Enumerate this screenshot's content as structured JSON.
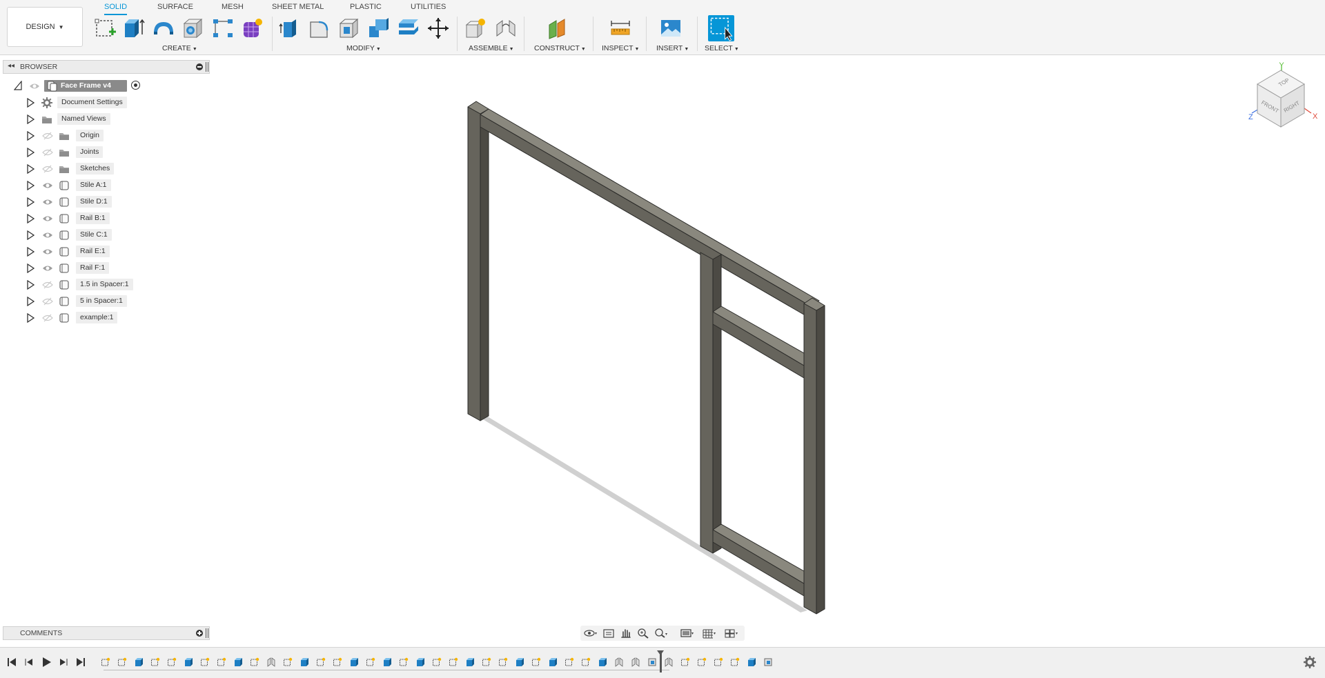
{
  "toolbar": {
    "design_label": "DESIGN",
    "tabs": [
      "SOLID",
      "SURFACE",
      "MESH",
      "SHEET METAL",
      "PLASTIC",
      "UTILITIES"
    ],
    "active_tab": "SOLID",
    "groups": [
      "CREATE",
      "MODIFY",
      "ASSEMBLE",
      "CONSTRUCT",
      "INSPECT",
      "INSERT",
      "SELECT"
    ]
  },
  "browser": {
    "title": "BROWSER",
    "root": {
      "label": "Face Frame v4"
    },
    "items": [
      {
        "label": "Document Settings",
        "icon": "gear-icon",
        "eye": "none"
      },
      {
        "label": "Named Views",
        "icon": "folder-icon",
        "eye": "none"
      },
      {
        "label": "Origin",
        "icon": "folder-icon",
        "eye": "hidden"
      },
      {
        "label": "Joints",
        "icon": "folder-icon",
        "eye": "hidden"
      },
      {
        "label": "Sketches",
        "icon": "folder-icon",
        "eye": "hidden"
      },
      {
        "label": "Stile A:1",
        "icon": "component-icon",
        "eye": "visible"
      },
      {
        "label": "Stile D:1",
        "icon": "component-icon",
        "eye": "visible"
      },
      {
        "label": "Rail B:1",
        "icon": "component-icon",
        "eye": "visible"
      },
      {
        "label": "Stile C:1",
        "icon": "component-icon",
        "eye": "visible"
      },
      {
        "label": "Rail E:1",
        "icon": "component-icon",
        "eye": "visible"
      },
      {
        "label": "Rail F:1",
        "icon": "component-icon",
        "eye": "visible"
      },
      {
        "label": "1.5 in Spacer:1",
        "icon": "component-icon",
        "eye": "hidden"
      },
      {
        "label": "5 in Spacer:1",
        "icon": "component-icon",
        "eye": "hidden"
      },
      {
        "label": "example:1",
        "icon": "component-icon",
        "eye": "hidden"
      }
    ]
  },
  "viewcube": {
    "top": "TOP",
    "front": "FRONT",
    "right": "RIGHT",
    "axis_x": "X",
    "axis_y": "Y",
    "axis_z": "Z"
  },
  "comments": {
    "title": "COMMENTS"
  },
  "colors": {
    "accent": "#0696d7",
    "frame_front": "#66645c",
    "frame_top": "#8a887e",
    "frame_side": "#4c4a44"
  }
}
